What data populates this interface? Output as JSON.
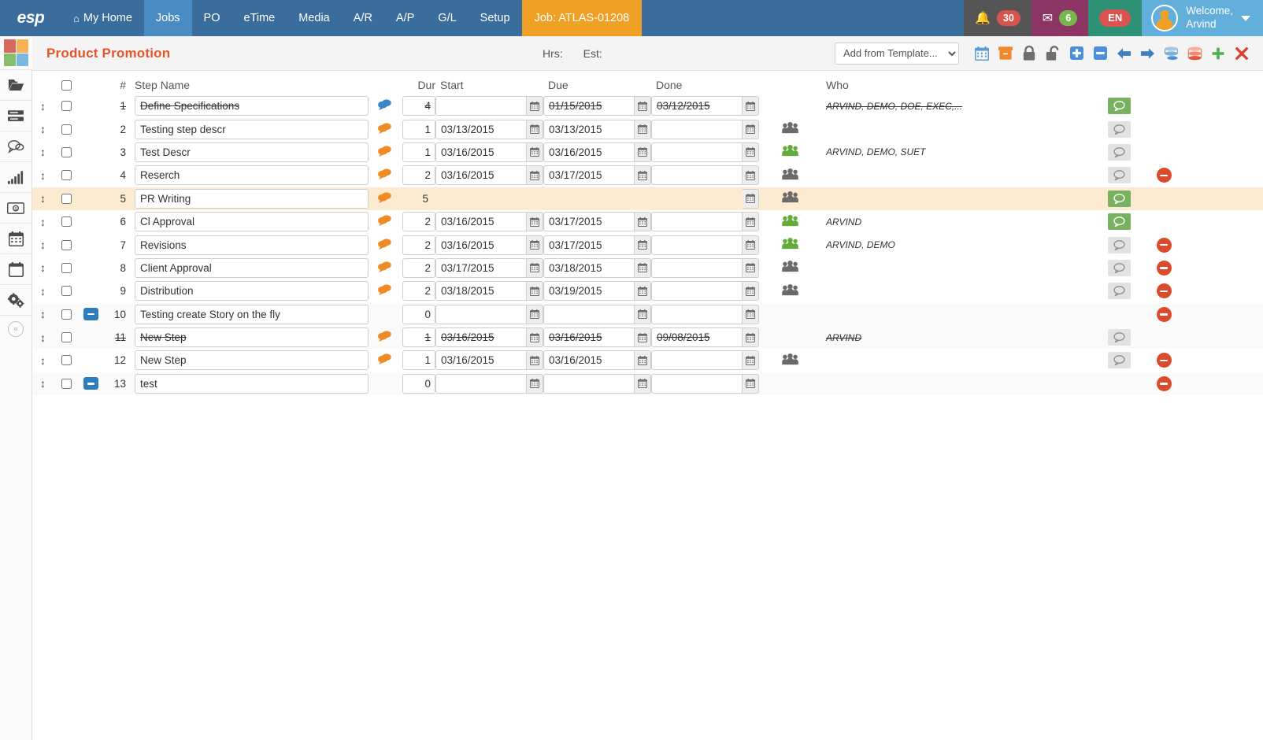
{
  "nav": {
    "brand": "esp",
    "items": [
      {
        "label": "My Home",
        "icon": "home-icon",
        "active": false
      },
      {
        "label": "Jobs",
        "active": true
      },
      {
        "label": "PO",
        "active": false
      },
      {
        "label": "eTime",
        "active": false
      },
      {
        "label": "Media",
        "active": false
      },
      {
        "label": "A/R",
        "active": false
      },
      {
        "label": "A/P",
        "active": false
      },
      {
        "label": "G/L",
        "active": false
      },
      {
        "label": "Setup",
        "active": false
      }
    ],
    "job_badge": "Job: ATLAS-01208",
    "notification_count": "30",
    "message_count": "6",
    "language": "EN",
    "welcome_line1": "Welcome,",
    "welcome_line2": "Arvind"
  },
  "colors": {
    "nav_bg": "#3a6c9c",
    "nav_active": "#4b8bc4",
    "job_badge": "#f0a024",
    "title": "#e2562a",
    "selected_row": "#fcebd0",
    "note_on": "#79b161",
    "delete": "#da4b2d",
    "group_green": "#63ab3a",
    "group_gray": "#6a6a6a"
  },
  "sidebar": {
    "logo_colors": [
      "#d9695c",
      "#f5b355",
      "#85bf6c",
      "#7bb8e0"
    ],
    "items": [
      {
        "name": "folder-icon"
      },
      {
        "name": "list-icon"
      },
      {
        "name": "chat-icon"
      },
      {
        "name": "chart-icon"
      },
      {
        "name": "money-icon"
      },
      {
        "name": "calendar-icon"
      },
      {
        "name": "calendar-blank-icon"
      },
      {
        "name": "gears-icon"
      }
    ],
    "collapse_label": "«"
  },
  "subheader": {
    "page_title": "Product Promotion",
    "hrs_label": "Hrs:",
    "est_label": "Est:",
    "template_selected": "Add from Template...",
    "template_options": [
      "Add from Template..."
    ],
    "toolbar": [
      {
        "name": "calendar-toolbar-icon"
      },
      {
        "name": "archive-box-icon"
      },
      {
        "name": "lock-icon"
      },
      {
        "name": "unlock-icon"
      },
      {
        "name": "add-box-icon"
      },
      {
        "name": "minus-box-icon"
      },
      {
        "name": "arrow-left-icon"
      },
      {
        "name": "arrow-right-icon"
      },
      {
        "name": "stack-blue-icon"
      },
      {
        "name": "stack-red-icon"
      },
      {
        "name": "plus-icon"
      },
      {
        "name": "close-x-icon"
      }
    ]
  },
  "table": {
    "headers": {
      "num": "#",
      "name": "Step Name",
      "dur": "Dur",
      "start": "Start",
      "due": "Due",
      "done": "Done",
      "who": "Who"
    },
    "rows": [
      {
        "num": "1",
        "name": "Define Specifications",
        "dur": "4",
        "start": "",
        "due": "01/15/2015",
        "done": "03/12/2015",
        "who": "ARVIND, DEMO, DOE, EXEC,...",
        "bubble": "blue",
        "group": "none",
        "note": "on",
        "deletable": false,
        "expandable": false,
        "strike": true,
        "stripe": false,
        "selected": false,
        "has_inputs": true
      },
      {
        "num": "2",
        "name": "Testing step descr",
        "dur": "1",
        "start": "03/13/2015",
        "due": "03/13/2015",
        "done": "",
        "who": "",
        "bubble": "orange",
        "group": "gray",
        "note": "off",
        "deletable": false,
        "expandable": false,
        "strike": false,
        "stripe": false,
        "selected": false,
        "has_inputs": true
      },
      {
        "num": "3",
        "name": "Test Descr",
        "dur": "1",
        "start": "03/16/2015",
        "due": "03/16/2015",
        "done": "",
        "who": "ARVIND, DEMO, SUET",
        "bubble": "orange",
        "group": "green",
        "note": "off",
        "deletable": false,
        "expandable": false,
        "strike": false,
        "stripe": false,
        "selected": false,
        "has_inputs": true
      },
      {
        "num": "4",
        "name": "Reserch",
        "dur": "2",
        "start": "03/16/2015",
        "due": "03/17/2015",
        "done": "",
        "who": "",
        "bubble": "orange",
        "group": "gray",
        "note": "off",
        "deletable": true,
        "expandable": false,
        "strike": false,
        "stripe": false,
        "selected": false,
        "has_inputs": true
      },
      {
        "num": "5",
        "name": "PR Writing",
        "dur": "5",
        "start": "",
        "due": "",
        "done": "",
        "who": "",
        "bubble": "orange",
        "group": "gray",
        "note": "on",
        "deletable": false,
        "expandable": false,
        "strike": false,
        "stripe": false,
        "selected": true,
        "has_inputs": false
      },
      {
        "num": "6",
        "name": "Cl Approval",
        "dur": "2",
        "start": "03/16/2015",
        "due": "03/17/2015",
        "done": "",
        "who": "ARVIND",
        "bubble": "orange",
        "group": "green",
        "note": "on",
        "deletable": false,
        "expandable": false,
        "strike": false,
        "stripe": false,
        "selected": false,
        "has_inputs": true
      },
      {
        "num": "7",
        "name": "Revisions",
        "dur": "2",
        "start": "03/16/2015",
        "due": "03/17/2015",
        "done": "",
        "who": "ARVIND, DEMO",
        "bubble": "orange",
        "group": "green",
        "note": "off",
        "deletable": true,
        "expandable": false,
        "strike": false,
        "stripe": false,
        "selected": false,
        "has_inputs": true
      },
      {
        "num": "8",
        "name": "Client Approval",
        "dur": "2",
        "start": "03/17/2015",
        "due": "03/18/2015",
        "done": "",
        "who": "",
        "bubble": "orange",
        "group": "gray",
        "note": "off",
        "deletable": true,
        "expandable": false,
        "strike": false,
        "stripe": false,
        "selected": false,
        "has_inputs": true
      },
      {
        "num": "9",
        "name": "Distribution",
        "dur": "2",
        "start": "03/18/2015",
        "due": "03/19/2015",
        "done": "",
        "who": "",
        "bubble": "orange",
        "group": "gray",
        "note": "off",
        "deletable": true,
        "expandable": false,
        "strike": false,
        "stripe": false,
        "selected": false,
        "has_inputs": true
      },
      {
        "num": "10",
        "name": "Testing create Story on the fly",
        "dur": "0",
        "start": "",
        "due": "",
        "done": "",
        "who": "",
        "bubble": "none",
        "group": "none",
        "note": "none",
        "deletable": true,
        "expandable": true,
        "strike": false,
        "stripe": true,
        "selected": false,
        "has_inputs": true
      },
      {
        "num": "11",
        "name": "New Step",
        "dur": "1",
        "start": "03/16/2015",
        "due": "03/16/2015",
        "done": "09/08/2015",
        "who": "ARVIND",
        "bubble": "orange",
        "group": "none",
        "note": "off",
        "deletable": false,
        "expandable": false,
        "strike": true,
        "stripe": true,
        "selected": false,
        "has_inputs": true
      },
      {
        "num": "12",
        "name": "New Step",
        "dur": "1",
        "start": "03/16/2015",
        "due": "03/16/2015",
        "done": "",
        "who": "",
        "bubble": "orange",
        "group": "gray",
        "note": "off",
        "deletable": true,
        "expandable": false,
        "strike": false,
        "stripe": false,
        "selected": false,
        "has_inputs": true
      },
      {
        "num": "13",
        "name": "test",
        "dur": "0",
        "start": "",
        "due": "",
        "done": "",
        "who": "",
        "bubble": "none",
        "group": "none",
        "note": "none",
        "deletable": true,
        "expandable": true,
        "strike": false,
        "stripe": true,
        "selected": false,
        "has_inputs": true
      }
    ]
  }
}
